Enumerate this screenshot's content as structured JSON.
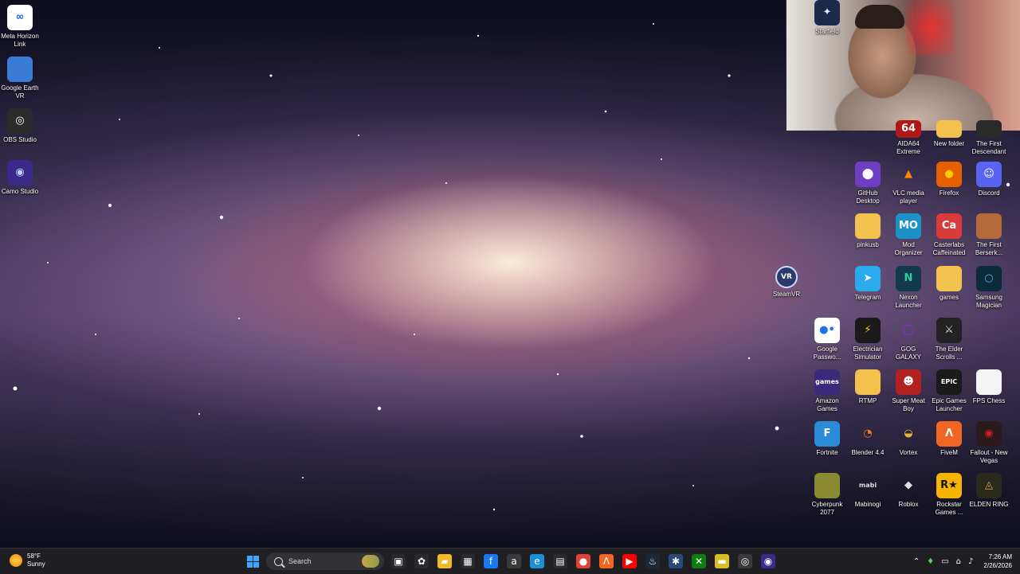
{
  "desktop": {
    "left_icons": [
      {
        "label": "Meta Horizon Link",
        "icon": "meta-icon",
        "glyph": "∞",
        "color": "#ffffff",
        "fg": "#0866ff"
      },
      {
        "label": "Google Earth VR",
        "icon": "google-earth-icon",
        "glyph": "",
        "color": "#3b7bd8",
        "fg": "#ffffff"
      },
      {
        "label": "OBS Studio",
        "icon": "obs-icon",
        "glyph": "◎",
        "color": "#2b2b2b",
        "fg": "#ffffff"
      },
      {
        "label": "Camo Studio",
        "icon": "camo-icon",
        "glyph": "◉",
        "color": "#3a2a8a",
        "fg": "#b9d3ff"
      }
    ],
    "steamvr": {
      "label": "SteamVR",
      "badge": "VR",
      "icon": "steamvr-icon"
    },
    "grid_icons": [
      {
        "label": "AIDA64 Extreme",
        "icon": "aida64-icon",
        "glyph": "64",
        "color": "#b01818",
        "fg": "#ffffff"
      },
      {
        "label": "New folder",
        "icon": "folder-icon",
        "glyph": "",
        "color": "#f2c14e",
        "fg": "#ffffff"
      },
      {
        "label": "The First Descendant",
        "icon": "game-icon",
        "glyph": "",
        "color": "#2a2a2a",
        "fg": "#ffffff"
      },
      {
        "label": "GitHub Desktop",
        "icon": "github-icon",
        "glyph": "⬤",
        "color": "#6e3fc2",
        "fg": "#ffffff"
      },
      {
        "label": "VLC media player",
        "icon": "vlc-icon",
        "glyph": "▲",
        "color": "rgba(0,0,0,0)",
        "fg": "#ff8800"
      },
      {
        "label": "Firefox",
        "icon": "firefox-icon",
        "glyph": "●",
        "color": "#e66000",
        "fg": "#ffcb00"
      },
      {
        "label": "Discord",
        "icon": "discord-icon",
        "glyph": "☺",
        "color": "#5865f2",
        "fg": "#ffffff"
      },
      {
        "label": "pinkusb",
        "icon": "folder-icon",
        "glyph": "",
        "color": "#f2c14e",
        "fg": "#ffffff"
      },
      {
        "label": "Mod Organizer",
        "icon": "mod-organizer-icon",
        "glyph": "MO",
        "color": "#1e90c8",
        "fg": "#ffffff"
      },
      {
        "label": "Casterlabs Caffeinated",
        "icon": "casterlabs-icon",
        "glyph": "Ca",
        "color": "#d93a3a",
        "fg": "#ffffff"
      },
      {
        "label": "The First Berserk...",
        "icon": "game-icon",
        "glyph": "",
        "color": "#b56a3a",
        "fg": "#ffffff"
      },
      {
        "label": "Telegram",
        "icon": "telegram-icon",
        "glyph": "➤",
        "color": "#2aabee",
        "fg": "#ffffff"
      },
      {
        "label": "Nexon Launcher",
        "icon": "nexon-icon",
        "glyph": "N",
        "color": "#123a4a",
        "fg": "#2ad0a0"
      },
      {
        "label": "games",
        "icon": "folder-icon",
        "glyph": "",
        "color": "#f2c14e",
        "fg": "#ffffff"
      },
      {
        "label": "Samsung Magician",
        "icon": "samsung-magician-icon",
        "glyph": "○",
        "color": "#0b2a3a",
        "fg": "#3fc0ff"
      },
      {
        "label": "Google Passwo...",
        "icon": "google-password-icon",
        "glyph": "●•",
        "color": "#ffffff",
        "fg": "#1a73e8"
      },
      {
        "label": "Electrician Simulator",
        "icon": "game-icon",
        "glyph": "⚡",
        "color": "#1a1a1a",
        "fg": "#ffd000"
      },
      {
        "label": "GOG GALAXY",
        "icon": "gog-icon",
        "glyph": "◯",
        "color": "rgba(0,0,0,0)",
        "fg": "#a020f0"
      },
      {
        "label": "The Elder Scrolls ...",
        "icon": "skyrim-icon",
        "glyph": "⚔",
        "color": "#222222",
        "fg": "#dddddd"
      },
      {
        "label": "Amazon Games",
        "icon": "amazon-games-icon",
        "glyph": "games",
        "color": "#3b2a7a",
        "fg": "#ffffff"
      },
      {
        "label": "RTMP",
        "icon": "folder-icon",
        "glyph": "",
        "color": "#f2c14e",
        "fg": "#ffffff"
      },
      {
        "label": "Super Meat Boy",
        "icon": "game-icon",
        "glyph": "☻",
        "color": "#b32020",
        "fg": "#ffffff"
      },
      {
        "label": "Epic Games Launcher",
        "icon": "epic-games-icon",
        "glyph": "EPIC",
        "color": "#1a1a1a",
        "fg": "#ffffff"
      },
      {
        "label": "FPS Chess",
        "icon": "file-icon",
        "glyph": "",
        "color": "#f4f4f4",
        "fg": "#999999"
      },
      {
        "label": "Fortnite",
        "icon": "fortnite-icon",
        "glyph": "F",
        "color": "#2b8bd6",
        "fg": "#ffffff"
      },
      {
        "label": "Blender 4.4",
        "icon": "blender-icon",
        "glyph": "◔",
        "color": "rgba(0,0,0,0)",
        "fg": "#f5792a"
      },
      {
        "label": "Vortex",
        "icon": "vortex-icon",
        "glyph": "◒",
        "color": "rgba(0,0,0,0)",
        "fg": "#e8b040"
      },
      {
        "label": "FiveM",
        "icon": "fivem-icon",
        "glyph": "Λ",
        "color": "#f26522",
        "fg": "#ffffff"
      },
      {
        "label": "Fallout - New Vegas",
        "icon": "game-icon",
        "glyph": "◉",
        "color": "#2a1a1a",
        "fg": "#d02020"
      },
      {
        "label": "Cyberpunk 2077",
        "icon": "game-icon",
        "glyph": "",
        "color": "#8a8a30",
        "fg": "#ffffff"
      },
      {
        "label": "Mabinogi",
        "icon": "game-icon",
        "glyph": "mabi",
        "color": "rgba(0,0,0,0)",
        "fg": "#dddddd"
      },
      {
        "label": "Roblox",
        "icon": "roblox-icon",
        "glyph": "◆",
        "color": "rgba(0,0,0,0)",
        "fg": "#e0e0e0"
      },
      {
        "label": "Rockstar Games ...",
        "icon": "rockstar-icon",
        "glyph": "R★",
        "color": "#f4b400",
        "fg": "#111111"
      },
      {
        "label": "ELDEN RING",
        "icon": "game-icon",
        "glyph": "◬",
        "color": "#2a2a1a",
        "fg": "#d8b050"
      },
      {
        "label": "Starfield",
        "icon": "game-icon",
        "glyph": "✦",
        "color": "#1c2a4a",
        "fg": "#dfe8ff"
      }
    ]
  },
  "taskbar": {
    "weather": {
      "temp": "58°F",
      "cond": "Sunny"
    },
    "search": {
      "label": "Search"
    },
    "apps": [
      {
        "name": "task-view",
        "glyph": "▣",
        "color": "#2a2a2e"
      },
      {
        "name": "copilot",
        "glyph": "✿",
        "color": "#2a2a2e"
      },
      {
        "name": "file-explorer",
        "glyph": "▰",
        "color": "#f2b92a"
      },
      {
        "name": "microsoft-store",
        "glyph": "▦",
        "color": "#2a2a2e"
      },
      {
        "name": "facebook",
        "glyph": "f",
        "color": "#1877f2"
      },
      {
        "name": "amazon",
        "glyph": "a",
        "color": "#3a3a3a"
      },
      {
        "name": "edge",
        "glyph": "e",
        "color": "#1a8fd8"
      },
      {
        "name": "calculator",
        "glyph": "▤",
        "color": "#2a2a2e"
      },
      {
        "name": "chrome",
        "glyph": "●",
        "color": "#db4437"
      },
      {
        "name": "fivem",
        "glyph": "Λ",
        "color": "#f26522"
      },
      {
        "name": "youtube",
        "glyph": "▶",
        "color": "#ff0000"
      },
      {
        "name": "steam",
        "glyph": "♨",
        "color": "#1b2838"
      },
      {
        "name": "app",
        "glyph": "✱",
        "color": "#2a4a7a"
      },
      {
        "name": "xbox",
        "glyph": "✕",
        "color": "#107c10"
      },
      {
        "name": "sticky",
        "glyph": "▬",
        "color": "#d8c020"
      },
      {
        "name": "obs",
        "glyph": "◎",
        "color": "#3a3a3a"
      },
      {
        "name": "camo",
        "glyph": "◉",
        "color": "#3a2a8a"
      }
    ],
    "clock": {
      "time": "7:26 AM",
      "date": "2/26/2026"
    }
  }
}
